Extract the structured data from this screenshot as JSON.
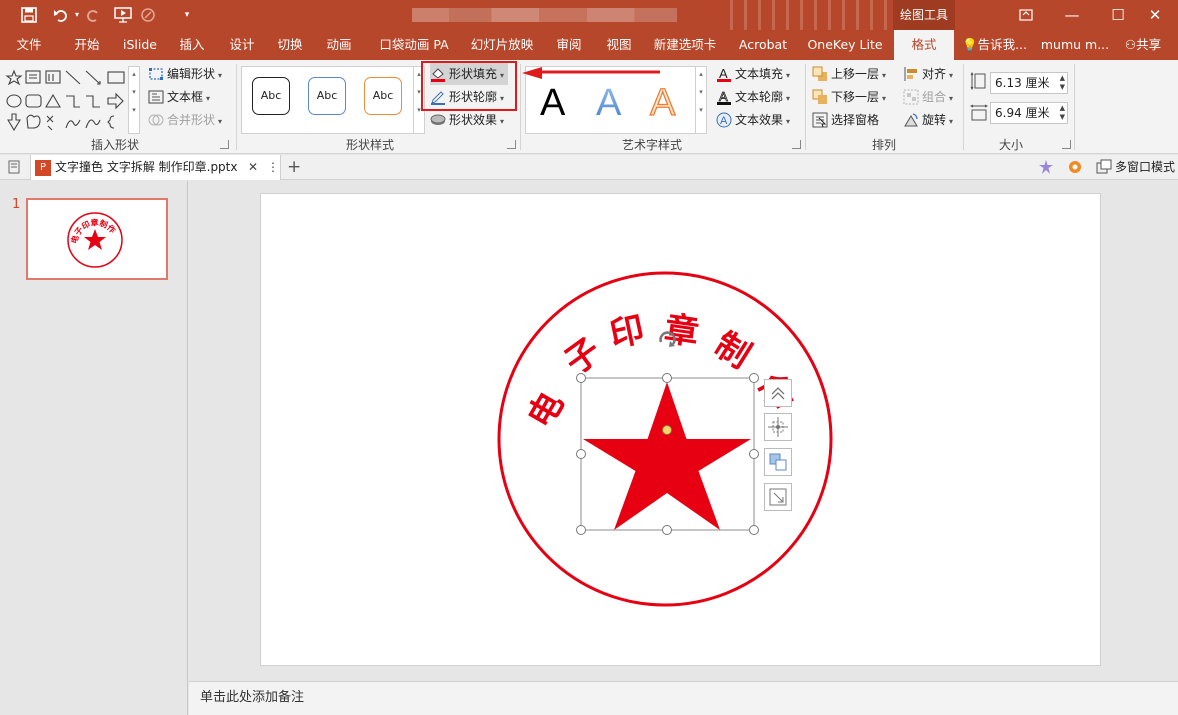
{
  "titlebar": {
    "tools_context": "绘图工具",
    "icons": [
      "save-icon",
      "undo-icon",
      "redo-icon",
      "slideshow-icon",
      "touch-mode-icon",
      "customize-qat-icon"
    ]
  },
  "menu": {
    "tabs": [
      "文件",
      "开始",
      "iSlide",
      "插入",
      "设计",
      "切换",
      "动画",
      "口袋动画 PA",
      "幻灯片放映",
      "审阅",
      "视图",
      "新建选项卡",
      "Acrobat",
      "OneKey Lite",
      "格式"
    ],
    "active_tab": "格式",
    "tell_me": "告诉我...",
    "user": "mumu m...",
    "share": "共享"
  },
  "ribbon": {
    "insert_shapes": {
      "label": "插入形状",
      "edit_shape": "编辑形状",
      "text_box": "文本框",
      "merge_shapes": "合并形状"
    },
    "shape_styles": {
      "label": "形状样式",
      "sample_text": "Abc",
      "shape_fill": "形状填充",
      "shape_outline": "形状轮廓",
      "shape_effects": "形状效果"
    },
    "wordart_styles": {
      "label": "艺术字样式",
      "sample": "A",
      "text_fill": "文本填充",
      "text_outline": "文本轮廓",
      "text_effects": "文本效果"
    },
    "arrange": {
      "label": "排列",
      "bring_forward": "上移一层",
      "send_backward": "下移一层",
      "selection_pane": "选择窗格",
      "align": "对齐",
      "group": "组合",
      "rotate": "旋转"
    },
    "size": {
      "label": "大小",
      "height": "6.13 厘米",
      "width": "6.94 厘米"
    }
  },
  "docbar": {
    "filename": "文字撞色 文字拆解 制作印章.pptx",
    "multi_window": "多窗口模式"
  },
  "thumbnails": [
    {
      "number": "1",
      "seal_text": "电子印章制作"
    }
  ],
  "slide": {
    "seal_chars": [
      "电",
      "子",
      "印",
      "章",
      "制",
      "作"
    ],
    "seal_color": "#e60012"
  },
  "notes": {
    "placeholder": "单击此处添加备注"
  },
  "colors": {
    "accent": "#b7472a",
    "highlight": "#e01a1a"
  }
}
